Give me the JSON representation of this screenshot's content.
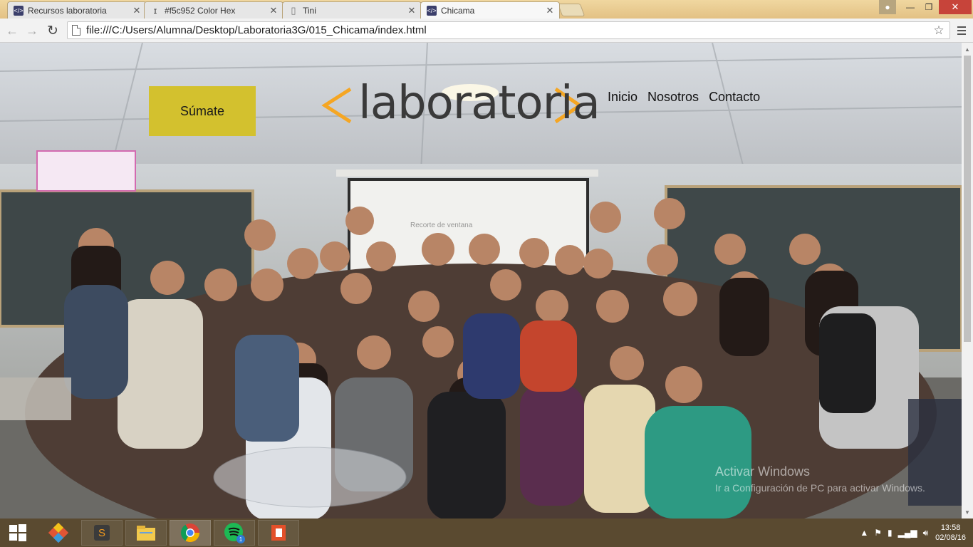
{
  "browser": {
    "tabs": [
      {
        "label": "Recursos laboratoria",
        "icon": "code-favicon-icon"
      },
      {
        "label": "#f5c952 Color Hex",
        "icon": "pin-favicon-icon"
      },
      {
        "label": "Tini",
        "icon": "document-favicon-icon"
      },
      {
        "label": "Chicama",
        "icon": "code-favicon-icon",
        "active": true
      }
    ],
    "url": "file:///C:/Users/Alumna/Desktop/Laboratoria3G/015_Chicama/index.html"
  },
  "page": {
    "join_button": "Súmate",
    "logo_text": "laboratoria",
    "nav": [
      "Inicio",
      "Nosotros",
      "Contacto"
    ],
    "overlay_hint": "Recorte de ventana",
    "watermark_title": "Activar Windows",
    "watermark_sub": "Ir a Configuración de PC para activar Windows.",
    "colors": {
      "join_button": "#d3c12e",
      "logo_brackets": "#f5a623",
      "logo_text": "#3a3a3a"
    }
  },
  "taskbar": {
    "apps": [
      "windows-start-icon",
      "git-icon",
      "sublime-text-icon",
      "file-explorer-icon",
      "chrome-icon",
      "spotify-icon",
      "office-icon"
    ],
    "spotify_badge": "1",
    "time": "13:58",
    "date": "02/08/16"
  }
}
